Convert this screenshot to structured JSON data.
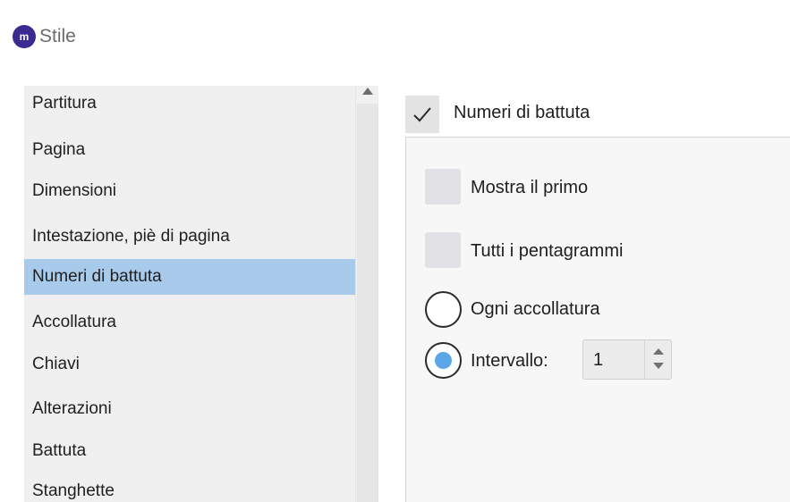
{
  "window": {
    "title": "Stile",
    "logo_text": "m",
    "logo_icon": "musescore-logo-icon"
  },
  "sidebar": {
    "items": [
      {
        "label": "Partitura",
        "selected": false
      },
      {
        "label": "Pagina",
        "selected": false
      },
      {
        "label": "Dimensioni",
        "selected": false
      },
      {
        "label": "Intestazione, piè di pagina",
        "selected": false
      },
      {
        "label": "Numeri di battuta",
        "selected": true
      },
      {
        "label": "Accollatura",
        "selected": false
      },
      {
        "label": "Chiavi",
        "selected": false
      },
      {
        "label": "Alterazioni",
        "selected": false
      },
      {
        "label": "Battuta",
        "selected": false
      },
      {
        "label": "Stanghette",
        "selected": false
      }
    ]
  },
  "panel": {
    "title": "Numeri di battuta",
    "enabled": true,
    "mostra_il_primo": {
      "label": "Mostra il primo",
      "checked": false
    },
    "tutti_i_pentagrammi": {
      "label": "Tutti i pentagrammi",
      "checked": false
    },
    "ogni_accollatura": {
      "label": "Ogni accollatura",
      "selected": false
    },
    "intervallo": {
      "label": "Intervallo:",
      "selected": true,
      "value": "1"
    }
  },
  "colors": {
    "selected_row": "#a8cbec",
    "radio_dot": "#5aa6e6",
    "logo_bg": "#3b2a8f"
  }
}
